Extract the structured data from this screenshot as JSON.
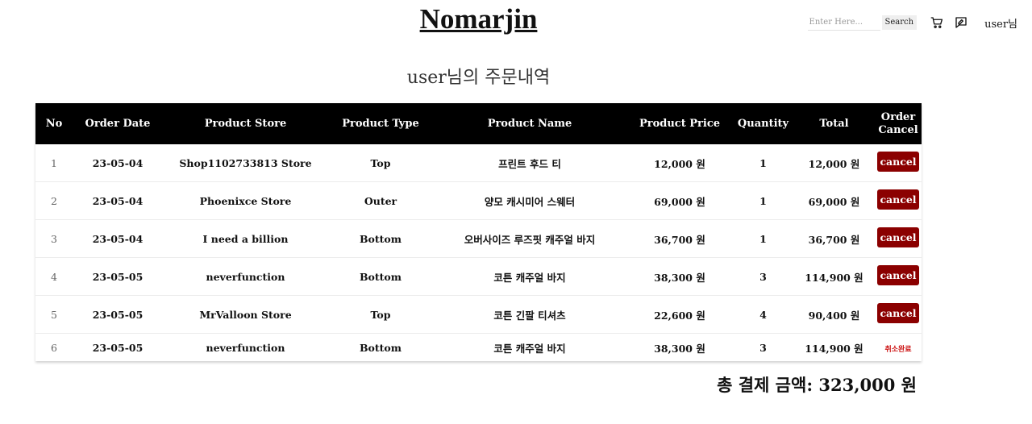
{
  "header": {
    "brand": "Nomarjin",
    "search": {
      "placeholder": "Enter Here...",
      "button_label": "Search"
    },
    "icons": [
      "cart-icon",
      "board-icon"
    ],
    "user_label": "user님"
  },
  "page_title": "user님의 주문내역",
  "table": {
    "columns": [
      "No",
      "Order Date",
      "Product Store",
      "Product Type",
      "Product Name",
      "Product Price",
      "Quantity",
      "Total",
      "Order Cancel"
    ],
    "rows": [
      {
        "no": "1",
        "date": "23-05-04",
        "store": "Shop1102733813 Store",
        "type": "Top",
        "name": "프린트 후드 티",
        "price": "12,000 원",
        "qty": "1",
        "total": "12,000 원",
        "cancel": "cancel"
      },
      {
        "no": "2",
        "date": "23-05-04",
        "store": "Phoenixce Store",
        "type": "Outer",
        "name": "양모 캐시미어 스웨터",
        "price": "69,000 원",
        "qty": "1",
        "total": "69,000 원",
        "cancel": "cancel"
      },
      {
        "no": "3",
        "date": "23-05-04",
        "store": "I need a billion",
        "type": "Bottom",
        "name": "오버사이즈 루즈핏 캐주얼 바지",
        "price": "36,700 원",
        "qty": "1",
        "total": "36,700 원",
        "cancel": "cancel"
      },
      {
        "no": "4",
        "date": "23-05-05",
        "store": "neverfunction",
        "type": "Bottom",
        "name": "코튼 캐주얼 바지",
        "price": "38,300 원",
        "qty": "3",
        "total": "114,900 원",
        "cancel": "cancel"
      },
      {
        "no": "5",
        "date": "23-05-05",
        "store": "MrValloon Store",
        "type": "Top",
        "name": "코튼 긴팔 티셔츠",
        "price": "22,600 원",
        "qty": "4",
        "total": "90,400 원",
        "cancel": "cancel"
      },
      {
        "no": "6",
        "date": "23-05-05",
        "store": "neverfunction",
        "type": "Bottom",
        "name": "코튼 캐주얼 바지",
        "price": "38,300 원",
        "qty": "3",
        "total": "114,900 원",
        "cancel": "취소완료"
      }
    ]
  },
  "total_payment": "총 결제 금액: 323,000 원",
  "colors": {
    "header_bg": "#000000",
    "cancel_button": "#8b0000",
    "cancelled_text": "#cc1111"
  }
}
